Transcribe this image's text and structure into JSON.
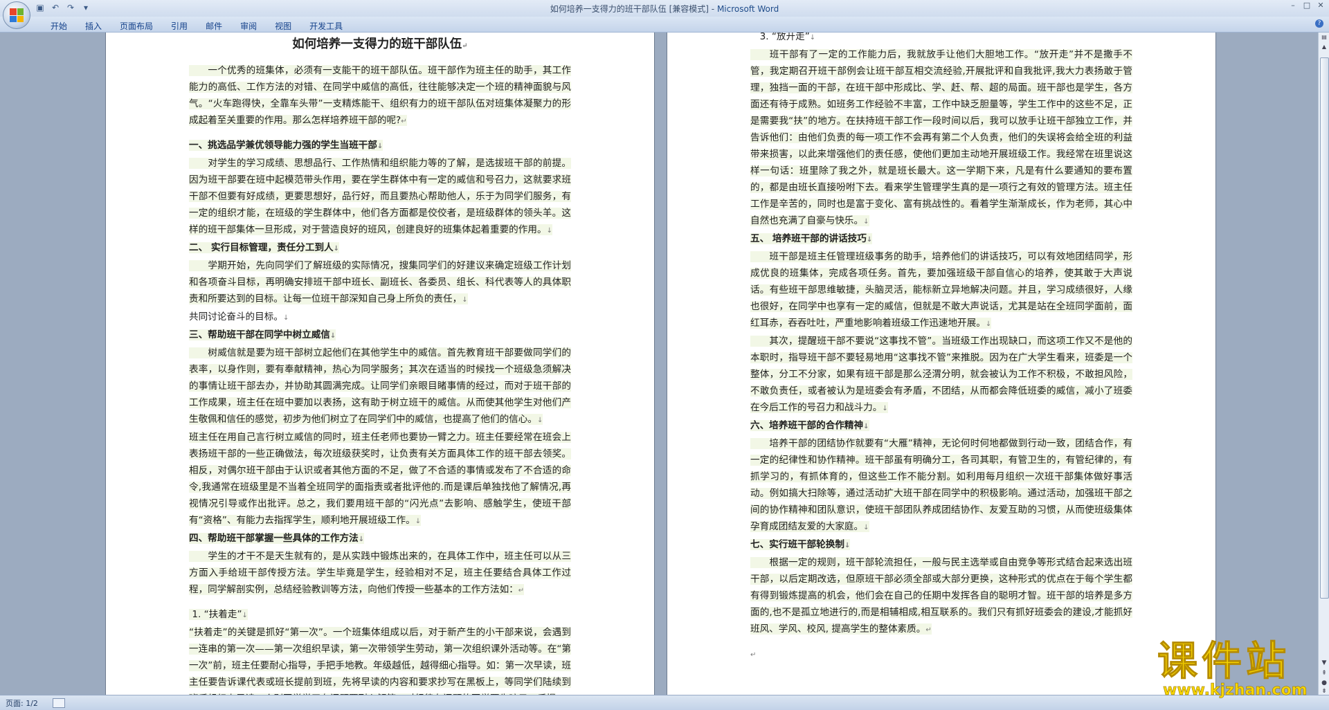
{
  "window": {
    "doc_name": "如何培养一支得力的班干部队伍 [兼容模式]",
    "separator": " - ",
    "app_name": "Microsoft Word"
  },
  "ribbon": {
    "tabs": [
      "开始",
      "插入",
      "页面布局",
      "引用",
      "邮件",
      "审阅",
      "视图",
      "开发工具"
    ]
  },
  "doc": {
    "title": "如何培养一支得力的班干部队伍",
    "intro": "一个优秀的班集体，必须有一支能干的班干部队伍。班干部作为班主任的助手，其工作能力的高低、工作方法的对错、在同学中威信的高低，往往能够决定一个班的精神面貌与风气。“火车跑得快，全靠车头带”一支精炼能干、组织有力的班干部队伍对班集体凝聚力的形成起着至关重要的作用。那么怎样培养班干部的呢?",
    "h1": "一、挑选品学兼优领导能力强的学生当班干部",
    "p1": "对学生的学习成绩、思想品行、工作热情和组织能力等的了解，是选拔班干部的前提。因为班干部要在班中起模范带头作用，要在学生群体中有一定的威信和号召力，这就要求班干部不但要有好成绩，更要思想好，品行好，而且要热心帮助他人，乐于为同学们服务，有一定的组织才能，在班级的学生群体中，他们各方面都是佼佼者，是班级群体的领头羊。这样的班干部集体一旦形成，对于营造良好的班风，创建良好的班集体起着重要的作用。",
    "h2": "二、 实行目标管理，责任分工到人",
    "p2a": "学期开始，先向同学们了解班级的实际情况，搜集同学们的好建议来确定班级工作计划和各项奋斗目标，再明确安排班干部中班长、副班长、各委员、组长、科代表等人的具体职责和所要达到的目标。让每一位班干部深知自己身上所负的责任，",
    "p2b": "共同讨论奋斗的目标。",
    "h3": "三、帮助班干部在同学中树立威信",
    "p3a": "树威信就是要为班干部树立起他们在其他学生中的威信。首先教育班干部要做同学们的表率，以身作则，要有奉献精神，热心为同学服务；其次在适当的时候找一个班级急须解决的事情让班干部去办，并协助其圆满完成。让同学们亲眼目睹事情的经过，而对于班干部的工作成果，班主任在班中要加以表扬，这有助于树立班干的威信。从而使其他学生对他们产生敬佩和信任的感觉，初步为他们树立了在同学们中的威信，也提高了他们的信心。",
    "p3b": "班主任在用自己言行树立威信的同时，班主任老师也要协一臂之力。班主任要经常在班会上表扬班干部的一些正确做法，每次班级获奖时，让负责有关方面具体工作的班干部去领奖。相反，对偶尔班干部由于认识或者其他方面的不足，做了不合适的事情或发布了不合适的命令,我通常在班级里是不当着全班同学的面指责或者批评他的.而是课后单独找他了解情况,再视情况引导或作出批评。总之，我们要用班干部的“闪光点”去影响、感触学生，使班干部有“资格”、有能力去指挥学生，顺利地开展班级工作。",
    "h4": "四、帮助班干部掌握一些具体的工作方法",
    "p4": "学生的才干不是天生就有的，是从实践中锻炼出来的，在具体工作中，班主任可以从三方面入手给班干部传授方法。学生毕竟是学生，经验相对不足，班主任要结合具体工作过程，同学解剖实例，总结经验教训等方法，向他们传授一些基本的工作方法如：",
    "s1": "1. “扶着走”",
    "p5": "“扶着走”的关键是抓好“第一次”。一个班集体组成以后，对于新产生的小干部来说，会遇到一连串的第一次——第一次组织早读，第一次带领学生劳动，第一次组织课外活动等。在“第一次”前，班主任要耐心指导，手把手地教。年级越低，越得细心指导。如：第一次早读，班主任要告诉课代表或班长提前到班，先将早读的内容和要求抄写在黑板上，等同学们陆续到班后组织上早读，个别同学学习有问题要耐心解答，对纪律有问题的同学要先暗示，后提",
    "s3": "3. “放开走”",
    "p6": "班干部有了一定的工作能力后，我就放手让他们大胆地工作。“放开走”并不是撒手不管，我定期召开班干部例会让班干部互相交流经验,开展批评和自我批评,我大力表扬敢于管理，独挡一面的干部，在班干部中形成比、学、赶、帮、超的局面。班干部也是学生，各方面还有待于成熟。如班务工作经验不丰富，工作中缺乏胆量等，学生工作中的这些不足，正是需要我“扶”的地方。在扶持班干部工作一段时间以后，我可以放手让班干部独立工作，并告诉他们：由他们负责的每一项工作不会再有第二个人负责，他们的失误将会给全班的利益带来损害，以此来增强他们的责任感，使他们更加主动地开展班级工作。我经常在班里说这样一句话：班里除了我之外，就是班长最大。这一学期下来，凡是有什么要通知的要布置的，都是由班长直接吩咐下去。看来学生管理学生真的是一项行之有效的管理方法。班主任工作是辛苦的，同时也是富于变化、富有挑战性的。看着学生渐渐成长，作为老师，其心中自然也充满了自豪与快乐。",
    "h5": "五、 培养班干部的讲话技巧",
    "p7": "班干部是班主任管理班级事务的助手，培养他们的讲话技巧，可以有效地团结同学，形成优良的班集体，完成各项任务。首先，要加强班级干部自信心的培养，使其敢于大声说话。有些班干部思维敏捷，头脑灵活，能标新立异地解决问题。并且，学习成绩很好，人缘也很好，在同学中也享有一定的威信，但就是不敢大声说话，尤其是站在全班同学面前，面红耳赤，吞吞吐吐，严重地影响着班级工作迅速地开展。",
    "p8": "其次，提醒班干部不要说“这事找不管”。当班级工作出现缺口，而这项工作又不是他的本职时，指导班干部不要轻易地用“这事找不管”来推脱。因为在广大学生看来，班委是一个整体，分工不分家，如果有班干部是那么泾渭分明，就会被认为工作不积极，不敢担风险，不敢负责任，或者被认为是班委会有矛盾，不团结，从而都会降低班委的威信，减小了班委在今后工作的号召力和战斗力。",
    "h6": "六、培养班干部的合作精神",
    "p9": "培养干部的团结协作就要有“大雁”精神，无论何时何地都做到行动一致，团结合作，有一定的纪律性和协作精神。班干部虽有明确分工，各司其职，有管卫生的，有管纪律的，有抓学习的，有抓体育的，但这些工作不能分割。如利用每月组织一次班干部集体做好事活动。例如搞大扫除等，通过活动扩大班干部在同学中的积极影响。通过活动，加强班干部之间的协作精神和团队意识，使班干部团队养成团结协作、友爱互助的习惯，从而使班级集体孕育成团结友爱的大家庭。",
    "h7": "七、实行班干部轮换制",
    "p10": "根据一定的规则，班干部轮流担任，一般与民主选举或自由竞争等形式结合起来选出班干部，以后定期改选，但原班干部必须全部或大部分更换，这种形式的优点在于每个学生都有得到锻炼提高的机会，他们会在自己的任期中发挥各自的聪明才智。班干部的培养是多方面的,也不是孤立地进行的,而是相辅相成,相互联系的。我们只有抓好班委会的建设,才能抓好班风、学风、校风, 提高学生的整体素质。"
  },
  "status": {
    "page": "页面: 1/2"
  },
  "watermark": {
    "title": "课件站",
    "url": "www.kjzhan.com"
  },
  "colors": {
    "paragraph_highlight": "#f2f7e6",
    "workspace": "#9cabc0",
    "watermark": "#f6d400"
  }
}
